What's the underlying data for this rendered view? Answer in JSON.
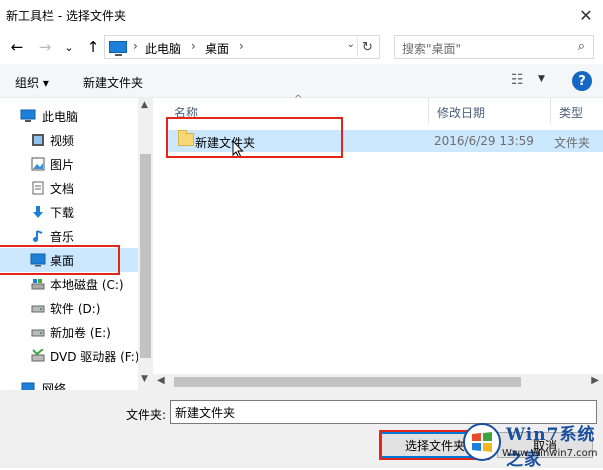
{
  "window": {
    "title": "新工具栏 - 选择文件夹",
    "close_glyph": "✕"
  },
  "nav": {
    "back": "←",
    "forward": "→",
    "recent": "⌄",
    "up": "↑",
    "address": {
      "segments": [
        "此电脑",
        "桌面"
      ],
      "chevron": "›",
      "dropdown": "⌄",
      "refresh": "↻"
    },
    "search_placeholder": "搜索\"桌面\"",
    "search_icon": "⌕"
  },
  "toolbar": {
    "organize": "组织 ▾",
    "new_folder": "新建文件夹",
    "view_icon": "☷",
    "view_dd": "▼",
    "help": "?"
  },
  "sidebar": {
    "items": [
      {
        "label": "此电脑",
        "icon": "pc-icon"
      },
      {
        "label": "视频",
        "icon": "video-icon"
      },
      {
        "label": "图片",
        "icon": "picture-icon"
      },
      {
        "label": "文档",
        "icon": "document-icon"
      },
      {
        "label": "下载",
        "icon": "download-icon"
      },
      {
        "label": "音乐",
        "icon": "music-icon"
      },
      {
        "label": "桌面",
        "icon": "desktop-icon",
        "selected": true
      },
      {
        "label": "本地磁盘 (C:)",
        "icon": "disk-icon"
      },
      {
        "label": "软件 (D:)",
        "icon": "drive-icon"
      },
      {
        "label": "新加卷 (E:)",
        "icon": "drive-icon"
      },
      {
        "label": "DVD 驱动器 (F:)",
        "icon": "dvd-icon"
      },
      {
        "label": "网络",
        "icon": "network-icon"
      }
    ]
  },
  "columns": {
    "name": "名称",
    "date": "修改日期",
    "type": "类型"
  },
  "files": [
    {
      "name": "新建文件夹",
      "date": "2016/6/29 13:59",
      "type": "文件夹"
    }
  ],
  "footer": {
    "folder_label": "文件夹:",
    "folder_value": "新建文件夹",
    "select_button": "选择文件夹",
    "cancel_button": "取消"
  },
  "watermark": {
    "title": "Win7系统之家",
    "url": "Www.Winwin7.com"
  },
  "colors": {
    "selection": "#cce8ff",
    "highlight_box": "#e2241a",
    "accent": "#0078d7"
  }
}
